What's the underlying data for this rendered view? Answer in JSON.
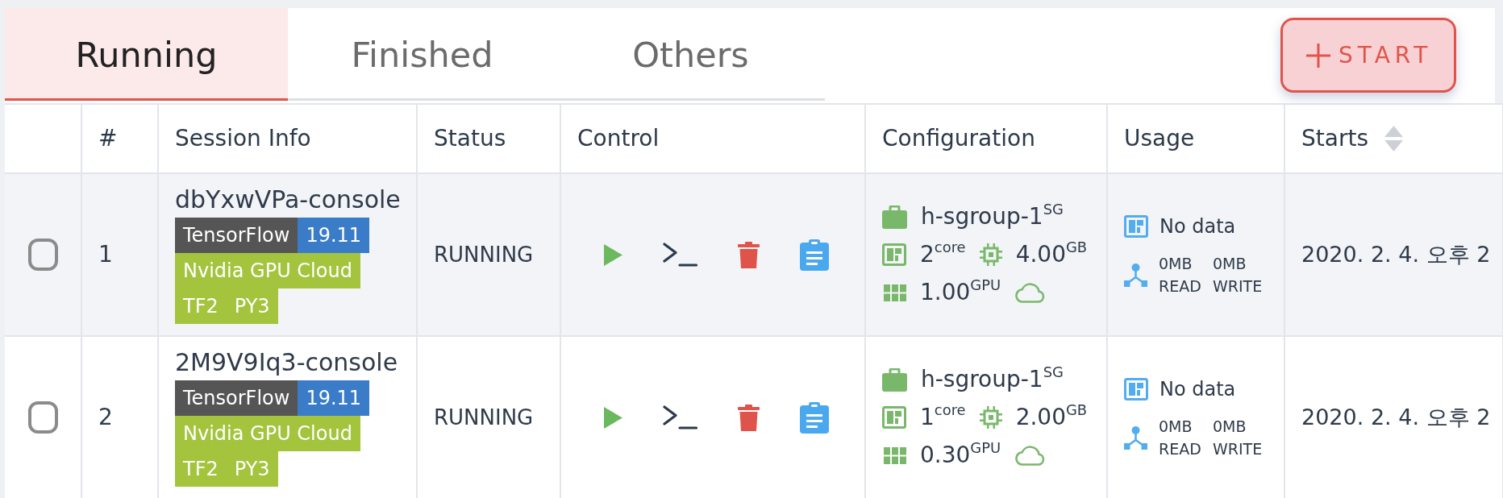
{
  "tabs": [
    {
      "label": "Running",
      "selected": true
    },
    {
      "label": "Finished",
      "selected": false
    },
    {
      "label": "Others",
      "selected": false
    }
  ],
  "start_button": {
    "label": "START"
  },
  "table": {
    "columns": [
      {
        "label": "#",
        "sortable": false
      },
      {
        "label": "Session Info",
        "sortable": false
      },
      {
        "label": "Status",
        "sortable": false
      },
      {
        "label": "Control",
        "sortable": false
      },
      {
        "label": "Configuration",
        "sortable": false
      },
      {
        "label": "Usage",
        "sortable": false
      },
      {
        "label": "Starts",
        "sortable": true
      }
    ],
    "rows": [
      {
        "checked": false,
        "number": "1",
        "session_name": "dbYxwVPa-console",
        "tags": [
          {
            "segments": [
              {
                "text": "TensorFlow",
                "color": "#555555"
              },
              {
                "text": "19.11",
                "color": "#3a7cc8"
              }
            ]
          },
          {
            "segments": [
              {
                "text": "Nvidia GPU Cloud",
                "color": "#a4c43e"
              }
            ]
          },
          {
            "segments": [
              {
                "text": "TF2",
                "color": "#a4c43e"
              },
              {
                "text": "PY3",
                "color": "#a4c43e"
              }
            ]
          }
        ],
        "status": "RUNNING",
        "configuration": {
          "scaling_group": "h-sgroup-1$^{SG}$",
          "cpu": "2$^{core}$",
          "memory": "4.00$^{GB}$",
          "gpu": "1.00$^{GPU}$"
        },
        "usage": {
          "reading": "No data",
          "read": "0MB",
          "write": "0MB",
          "read_label": "READ",
          "write_label": "WRITE"
        },
        "starts": "2020. 2. 4. 오후 2"
      },
      {
        "checked": false,
        "number": "2",
        "session_name": "2M9V9Iq3-console",
        "tags": [
          {
            "segments": [
              {
                "text": "TensorFlow",
                "color": "#555555"
              },
              {
                "text": "19.11",
                "color": "#3a7cc8"
              }
            ]
          },
          {
            "segments": [
              {
                "text": "Nvidia GPU Cloud",
                "color": "#a4c43e"
              }
            ]
          },
          {
            "segments": [
              {
                "text": "TF2",
                "color": "#a4c43e"
              },
              {
                "text": "PY3",
                "color": "#a4c43e"
              }
            ]
          }
        ],
        "status": "RUNNING",
        "configuration": {
          "scaling_group": "h-sgroup-1$^{SG}$",
          "cpu": "1$^{core}$",
          "memory": "2.00$^{GB}$",
          "gpu": "0.30$^{GPU}$"
        },
        "usage": {
          "reading": "No data",
          "read": "0MB",
          "write": "0MB",
          "read_label": "READ",
          "write_label": "WRITE"
        },
        "starts": "2020. 2. 4. 오후 2"
      }
    ]
  }
}
